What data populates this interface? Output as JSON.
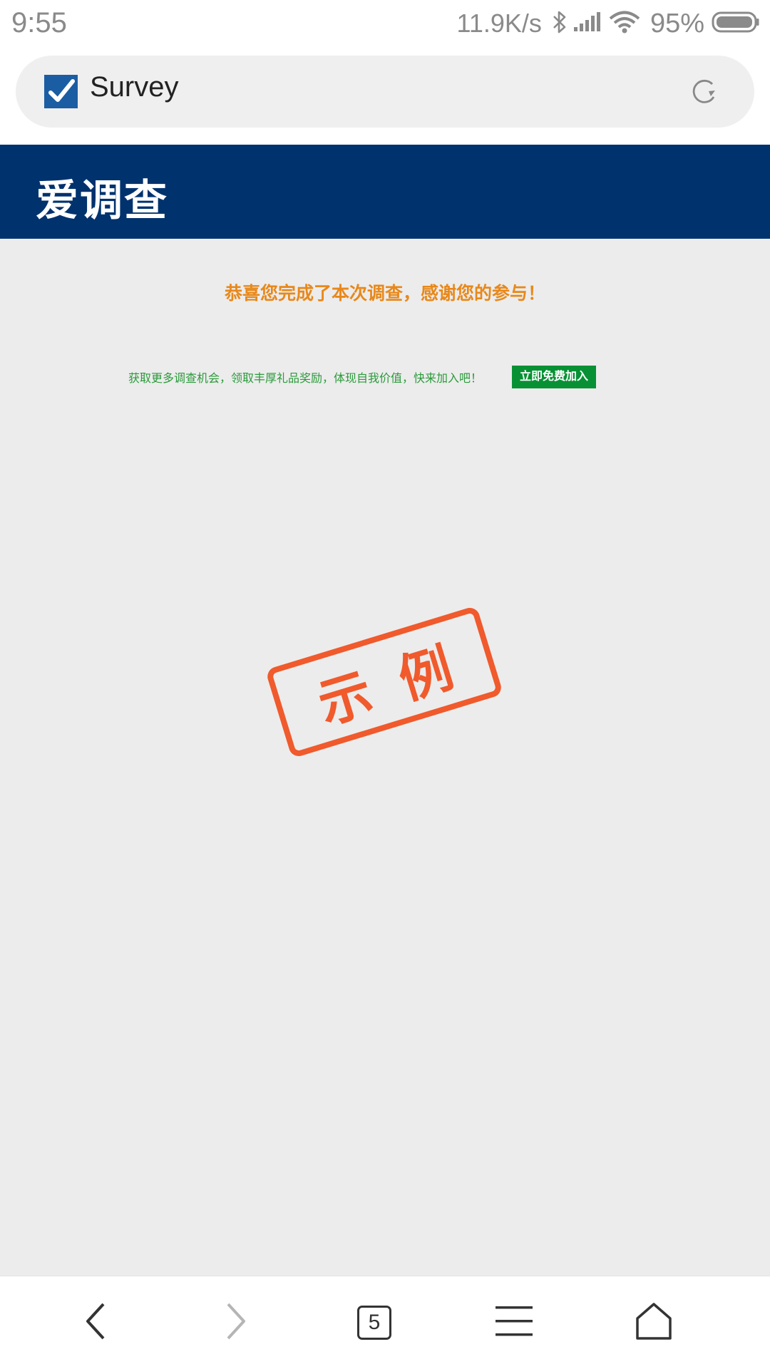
{
  "status_bar": {
    "time": "9:55",
    "network_speed": "11.9K/s",
    "battery": "95%",
    "icons": [
      "bluetooth-icon",
      "signal-icon",
      "wifi-icon",
      "battery-icon"
    ]
  },
  "address_bar": {
    "site_icon": "checkbox-check-icon",
    "title": "Survey",
    "refresh_icon": "refresh-icon"
  },
  "header": {
    "logo_text": "爱调查",
    "background": "#00326e"
  },
  "main": {
    "success_message": "恭喜您完成了本次调查，感谢您的参与！",
    "promo_text": "获取更多调查机会，领取丰厚礼品奖励，体现自我价值，快来加入吧！",
    "join_button": "立即免费加入",
    "stamp_text": "示例",
    "accent_orange": "#e8881a",
    "accent_green": "#079134",
    "stamp_color": "#f05a2c"
  },
  "bottom_nav": {
    "tab_count": "5",
    "icons": [
      "back-icon",
      "forward-icon",
      "tabs-icon",
      "menu-icon",
      "home-icon"
    ]
  }
}
